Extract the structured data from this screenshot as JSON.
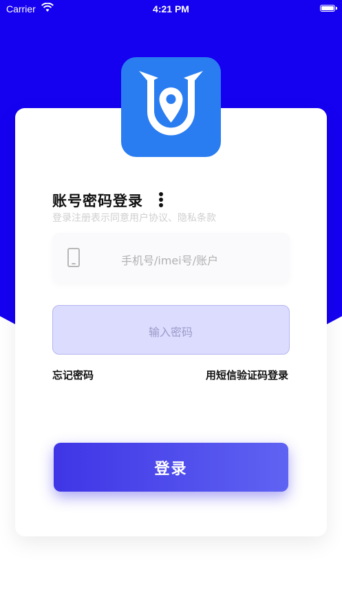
{
  "status_bar": {
    "carrier": "Carrier",
    "time": "4:21 PM"
  },
  "login": {
    "title": "账号密码登录",
    "subtitle": "登录注册表示同意用户协议、隐私条款",
    "account_placeholder": "手机号/imei号/账户",
    "password_placeholder": "输入密码",
    "forgot_password": "忘记密码",
    "sms_login": "用短信验证码登录",
    "submit": "登录"
  },
  "colors": {
    "header": "#1500f0",
    "logo_bg": "#2a7df0",
    "button_start": "#3f35e6",
    "button_end": "#5f63f2"
  },
  "icons": [
    "wifi-icon",
    "battery-icon",
    "app-logo",
    "more-icon",
    "phone-icon"
  ]
}
